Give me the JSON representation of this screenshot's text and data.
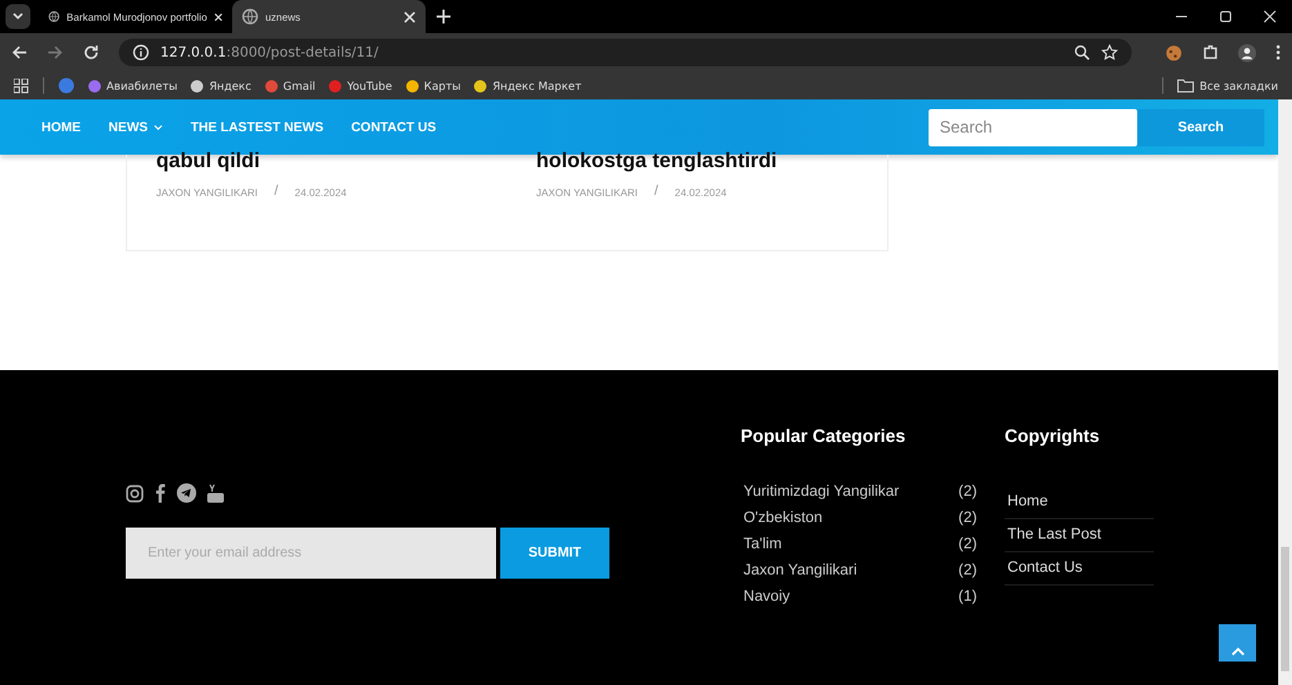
{
  "browser": {
    "tabs": [
      {
        "title": "Barkamol Murodjonov portfolio",
        "selected": false
      },
      {
        "title": "uznews",
        "selected": true
      }
    ],
    "url_host": "127.0.0.1",
    "url_rest": ":8000/post-details/11/",
    "bookmarks": [
      "Авиабилеты",
      "Яндекс",
      "Gmail",
      "YouTube",
      "Карты",
      "Яндекс Маркет"
    ],
    "all_bookmarks": "Все закладки"
  },
  "nav": {
    "items": [
      {
        "label": "HOME",
        "dropdown": false
      },
      {
        "label": "NEWS",
        "dropdown": true
      },
      {
        "label": "THE LASTEST NEWS",
        "dropdown": false
      },
      {
        "label": "CONTACT US",
        "dropdown": false
      }
    ],
    "search": {
      "placeholder": "Search",
      "button": "Search"
    }
  },
  "posts": [
    {
      "title": "qabul qildi",
      "author": "JAXON YANGILIKARI",
      "separator": "/",
      "date": "24.02.2024"
    },
    {
      "title": "holokostga tenglashtirdi",
      "author": "JAXON YANGILIKARI",
      "separator": "/",
      "date": "24.02.2024"
    }
  ],
  "footer": {
    "newsletter": {
      "placeholder": "Enter your email address",
      "button": "SUBMIT"
    },
    "categories_title": "Popular Categories",
    "categories": [
      {
        "name": "Yuritimizdagi Yangilikar",
        "count": "(2)"
      },
      {
        "name": "O'zbekiston",
        "count": "(2)"
      },
      {
        "name": "Ta'lim",
        "count": "(2)"
      },
      {
        "name": "Jaxon Yangilikari",
        "count": "(2)"
      },
      {
        "name": "Navoiy",
        "count": "(1)"
      }
    ],
    "links_title": "Copyrights",
    "links": [
      "Home",
      "The Last Post",
      "Contact Us"
    ]
  }
}
